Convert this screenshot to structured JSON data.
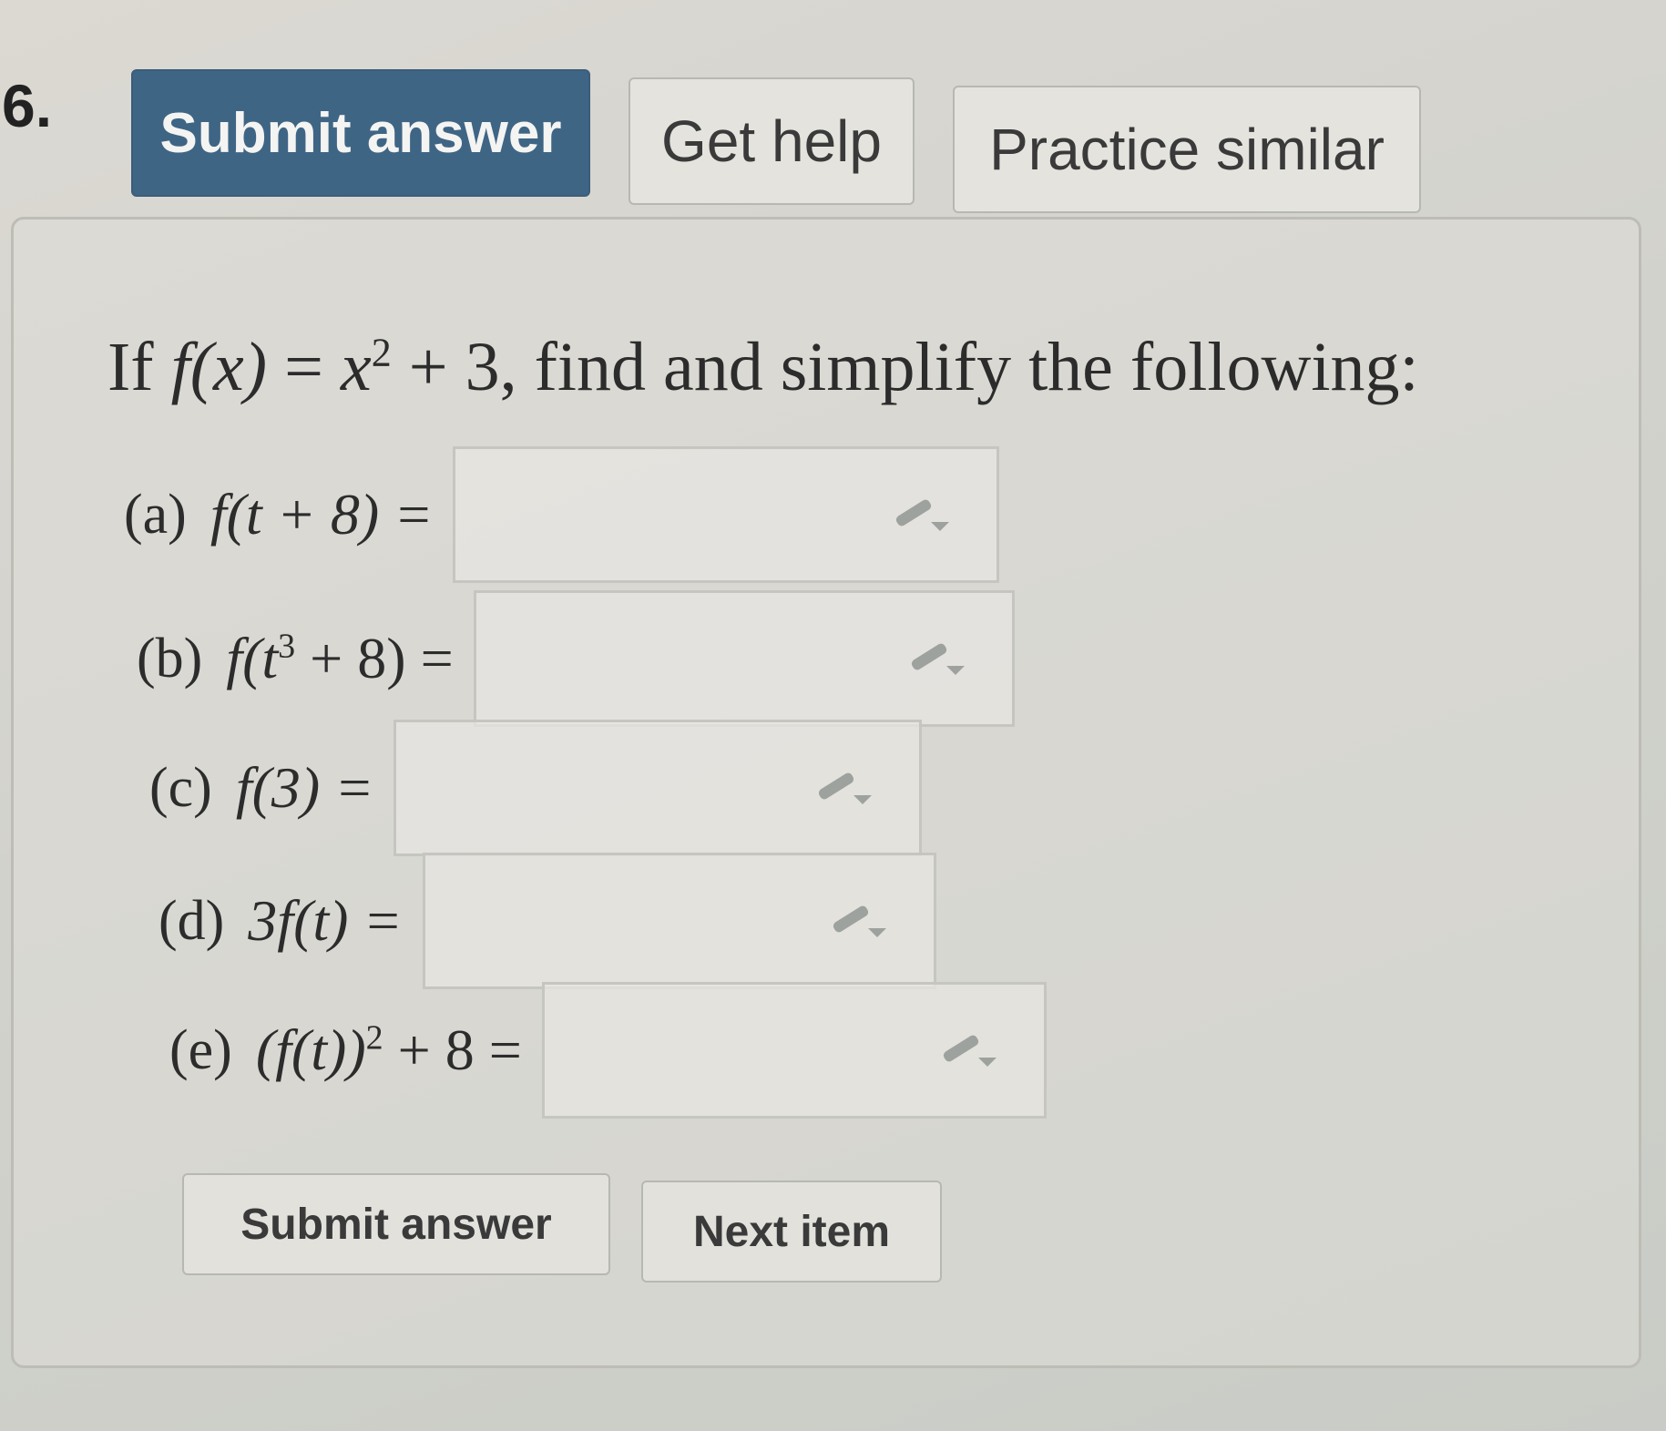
{
  "question": {
    "number": "6."
  },
  "toolbar": {
    "submit_label": "Submit answer",
    "help_label": "Get help",
    "practice_label": "Practice similar"
  },
  "prompt": {
    "lead": "If ",
    "fx": "f(x)",
    "eq": " = ",
    "x": "x",
    "exp": "2",
    "rest": " + 3, find and simplify the following:"
  },
  "parts": [
    {
      "label": "(a)",
      "expr_a": "f(t + 8) ="
    },
    {
      "label": "(b)",
      "expr_b1": "f(t",
      "expr_b_sup": "3",
      "expr_b2": " + 8) ="
    },
    {
      "label": "(c)",
      "expr_c": "f(3) ="
    },
    {
      "label": "(d)",
      "expr_d": "3f(t) ="
    },
    {
      "label": "(e)",
      "expr_e1": "(f(t))",
      "expr_e_sup": "2",
      "expr_e2": " + 8 ="
    }
  ],
  "answers": {
    "a": "",
    "b": "",
    "c": "",
    "d": "",
    "e": ""
  },
  "footer": {
    "submit_label": "Submit answer",
    "next_label": "Next item"
  },
  "colors": {
    "primary_button": "#3f6585",
    "background": "#d6d5cf",
    "border": "#bdbdb6"
  },
  "icons": {
    "answer_tool": "pencil-dropdown-icon"
  }
}
